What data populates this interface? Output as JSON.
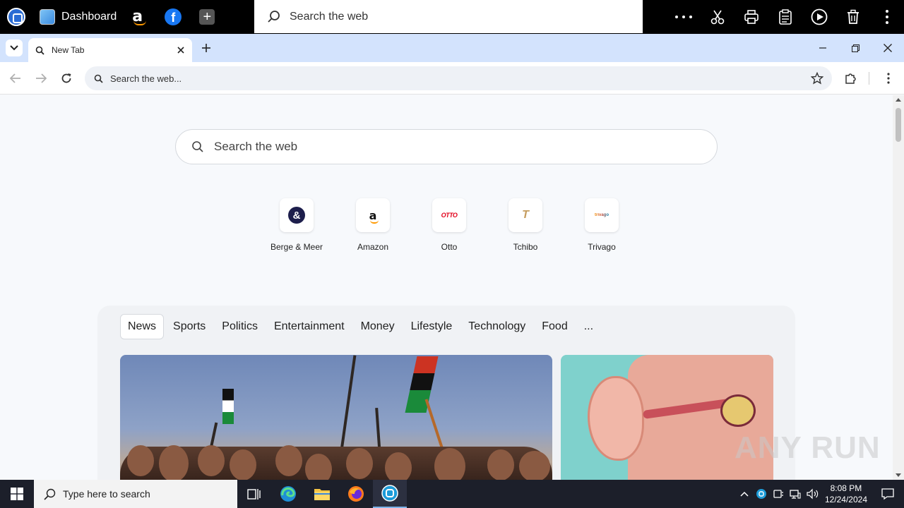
{
  "topbar": {
    "dashboard_label": "Dashboard",
    "search_placeholder": "Search the web",
    "amazon_letter": "a",
    "facebook_letter": "f",
    "plus_label": "+"
  },
  "tabstrip": {
    "tab_title": "New Tab"
  },
  "navbar": {
    "omnibox_placeholder": "Search the web..."
  },
  "newtab": {
    "search_placeholder": "Search the web",
    "quick_links": [
      {
        "label": "Berge & Meer",
        "logo": "&"
      },
      {
        "label": "Amazon",
        "logo": "a"
      },
      {
        "label": "Otto",
        "logo": "OTTO"
      },
      {
        "label": "Tchibo",
        "logo": "T"
      },
      {
        "label": "Trivago",
        "logo": "trivago"
      }
    ],
    "categories": [
      "News",
      "Sports",
      "Politics",
      "Entertainment",
      "Money",
      "Lifestyle",
      "Technology",
      "Food",
      "..."
    ]
  },
  "watermark": "ANY RUN",
  "taskbar": {
    "search_placeholder": "Type here to search",
    "time": "8:08 PM",
    "date": "12/24/2024"
  },
  "colors": {
    "accent": "#0b57d0",
    "tabstrip_bg": "#d3e3fd",
    "taskbar_bg": "#1c1f2a"
  }
}
